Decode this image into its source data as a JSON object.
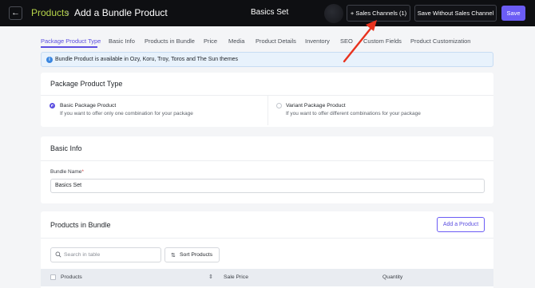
{
  "header": {
    "back_icon": "arrow-left-icon",
    "breadcrumb_root": "Products",
    "breadcrumb_sep": "›",
    "breadcrumb_current": "Add a Bundle Product",
    "title": "Basics Set",
    "sales_channels_label": "+ Sales Channels (1)",
    "save_without_label": "Save Without Sales Channel",
    "save_label": "Save"
  },
  "tabs": [
    {
      "label": "Package Product Type",
      "active": true
    },
    {
      "label": "Basic Info"
    },
    {
      "label": "Products in Bundle"
    },
    {
      "label": "Price"
    },
    {
      "label": "Media"
    },
    {
      "label": "Product Details"
    },
    {
      "label": "Inventory"
    },
    {
      "label": "SEO"
    },
    {
      "label": "Custom Fields"
    },
    {
      "label": "Product Customization"
    }
  ],
  "info_banner": {
    "icon": "info-icon",
    "text": "Bundle Product is available in Ozy, Koru, Troy, Toros and The Sun themes"
  },
  "package_type": {
    "title": "Package Product Type",
    "options": [
      {
        "title": "Basic Package Product",
        "description": "If you want to offer only one combination for your package",
        "selected": true
      },
      {
        "title": "Variant Package Product",
        "description": "If you want to offer different combinations for your package",
        "selected": false
      }
    ]
  },
  "basic_info": {
    "title": "Basic Info",
    "bundle_name_label": "Bundle Name",
    "required_mark": "*",
    "bundle_name_value": "Basics Set"
  },
  "products_in_bundle": {
    "title": "Products in Bundle",
    "add_label": "Add a Product",
    "search_placeholder": "Search in table",
    "sort_label": "Sort Products",
    "columns": [
      "Products",
      "Sale Price",
      "Quantity"
    ]
  },
  "colors": {
    "accent": "#6b5cf5",
    "breadcrumb": "#b7d64a",
    "annotation_arrow": "#e8321e"
  }
}
